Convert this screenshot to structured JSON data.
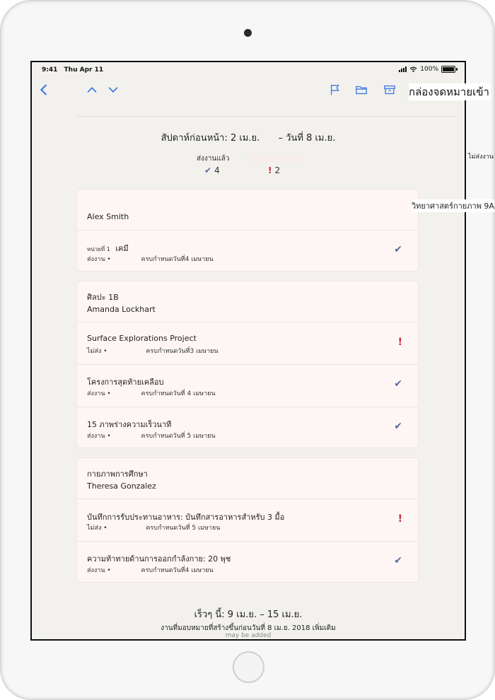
{
  "status": {
    "time": "9:41",
    "date": "Thu Apr 11",
    "battery": "100%"
  },
  "toolbar": {
    "inbox_title": "กล่องจดหมายเข้า"
  },
  "week": {
    "header_left": "สัปดาห์ก่อนหน้า: 2 เม.ย.",
    "header_right": "– วันที่ 8 เม.ย.",
    "turned_in_label": "ส่งงานแล้ว",
    "turned_in_count": "4",
    "missing_count": "2"
  },
  "outside": {
    "not_turned_in": "ไม่ส่งงาน",
    "class_name": "วิทยาศาสตร์กายภาพ 9A"
  },
  "classes": [
    {
      "name": "",
      "teacher": "Alex Smith",
      "rows": [
        {
          "sub": "หน่วยที่ 1",
          "title": "เคมี",
          "status": "ส่งงาน •",
          "due": "ครบกำหนดวันที่4 เมษายน",
          "state": "done"
        }
      ]
    },
    {
      "name": "ศิลปะ 1B",
      "teacher": "Amanda Lockhart",
      "rows": [
        {
          "sub": "",
          "title": "Surface Explorations Project",
          "status": "ไม่ส่ง •",
          "due": "ครบกำหนดวันที่3 เมษายน",
          "state": "missing"
        },
        {
          "sub": "",
          "title": "โครงการสุดท้ายเคลือบ",
          "status": "ส่งงาน •",
          "due": "ครบกำหนดวันที่ 4 เมษายน",
          "state": "done"
        },
        {
          "sub": "",
          "title": "15 ภาพร่างความเร็วนาที",
          "status": "ส่งงาน •",
          "due": "ครบกำหนดวันที่ 5 เมษายน",
          "state": "done"
        }
      ]
    },
    {
      "name": "กายภาพการศึกษา",
      "teacher": "Theresa Gonzalez",
      "rows": [
        {
          "sub": "",
          "title": "บันทึกการรับประทานอาหาร: บันทึกสารอาหารสำหรับ 3 มื้อ",
          "status": "ไม่ส่ง •",
          "due": "ครบกำหนดวันที่ 5 เมษายน",
          "state": "missing"
        },
        {
          "sub": "",
          "title": "ความท้าทายด้านการออกกำลังกาย: 20 พุช",
          "status": "ส่งงาน •",
          "due": "ครบกำหนดวันที่4 เมษายน",
          "state": "done"
        }
      ]
    }
  ],
  "soon": {
    "header": "เร็วๆ นี้: 9 เม.ย. – 15 เม.ย.",
    "note": "งานที่มอบหมายที่สร้างขึ้นก่อนวันที่ 8 เม.ย. 2018 เพิ่มเติม",
    "note_2": "may be added"
  },
  "icons": {
    "done": "✔",
    "missing": "!"
  },
  "colors": {
    "accent": "#3f7ce0",
    "check": "#5c6a9a",
    "missing": "#c8283b"
  }
}
